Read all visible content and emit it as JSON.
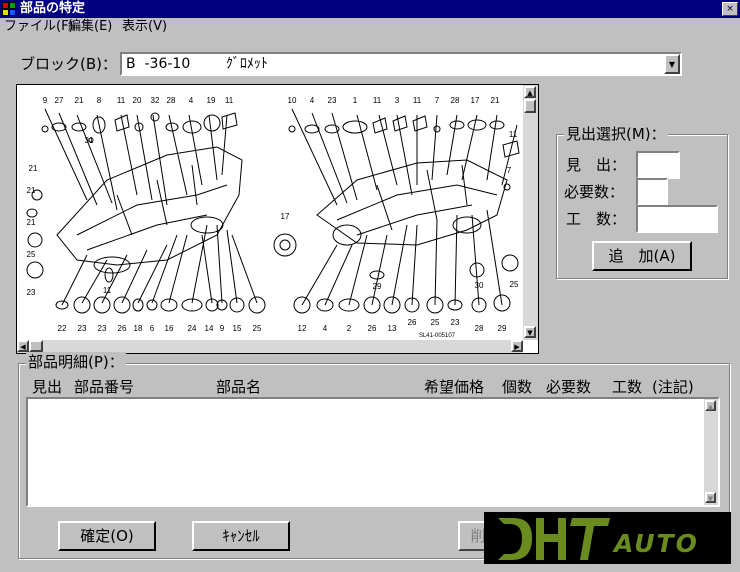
{
  "window": {
    "title": "部品の特定",
    "close_glyph": "×"
  },
  "menu": [
    {
      "label": "ファイル(F)"
    },
    {
      "label": "編集(E)"
    },
    {
      "label": "表示(V)"
    }
  ],
  "block": {
    "label": "ブロック(B)：",
    "value": "B  -36-10        ｸﾞﾛﾒｯﾄ"
  },
  "diagram": {
    "top_left_callouts": [
      "9",
      "27",
      "21",
      "8",
      "11",
      "20",
      "32",
      "28",
      "4",
      "19",
      "11"
    ],
    "top_right_callouts": [
      "10",
      "4",
      "23",
      "1",
      "11",
      "3",
      "11",
      "7",
      "28",
      "17",
      "21",
      "11"
    ],
    "bottom_left_callouts": [
      "22",
      "23",
      "23",
      "26",
      "18",
      "6",
      "16",
      "24",
      "14",
      "9",
      "15",
      "25"
    ],
    "bottom_right_callouts": [
      "12",
      "4",
      "2",
      "26",
      "13",
      "26",
      "25",
      "23",
      "28",
      "29"
    ],
    "side_callouts": [
      "21",
      "21",
      "21",
      "25",
      "23",
      "31",
      "17",
      "29",
      "30",
      "25",
      "7",
      "11"
    ],
    "ref_code": "SL41-005107"
  },
  "selection": {
    "legend": "見出選択(M)：",
    "heading_label": "見　出：",
    "required_label": "必要数：",
    "hours_label": "工　数：",
    "heading_value": "",
    "required_value": "",
    "hours_value": "",
    "add_button": "追　加(A)"
  },
  "details": {
    "legend": "部品明細(P)：",
    "columns": [
      "見出",
      "部品番号",
      "部品名",
      "希望価格",
      "個数",
      "必要数",
      "工数",
      "(注記)"
    ],
    "rows": []
  },
  "buttons": {
    "confirm": "確定(O)",
    "cancel": "ｷｬﾝｾﾙ",
    "delete_partial": "削"
  },
  "watermark": {
    "text": "AUTO"
  },
  "colors": {
    "title_bar": "#000080",
    "face": "#c0c0c0",
    "watermark_green": "#6a8b1e"
  }
}
